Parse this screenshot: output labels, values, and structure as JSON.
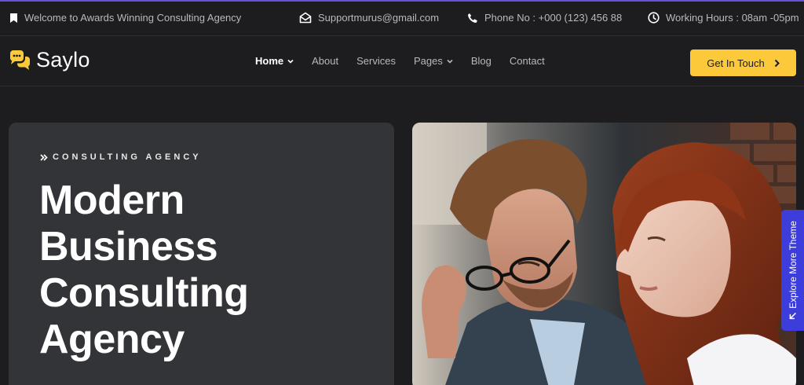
{
  "topbar": {
    "welcome": "Welcome to Awards Winning Consulting Agency",
    "email": "Supportmurus@gmail.com",
    "phone": "Phone No : +000 (123) 456 88",
    "hours": "Working Hours : 08am -05pm"
  },
  "brand": {
    "name": "Saylo",
    "accent": "#fcc93a"
  },
  "nav": {
    "items": [
      {
        "label": "Home",
        "dropdown": true,
        "active": true
      },
      {
        "label": "About"
      },
      {
        "label": "Services"
      },
      {
        "label": "Pages",
        "dropdown": true
      },
      {
        "label": "Blog"
      },
      {
        "label": "Contact"
      }
    ],
    "cta": "Get In Touch"
  },
  "hero": {
    "eyebrow": "CONSULTING AGENCY",
    "title_lines": [
      "Modern",
      "Business",
      "Consulting",
      "Agency"
    ]
  },
  "side_tab": {
    "label": "Explore More Theme",
    "color": "#3c3ddb"
  },
  "icons": [
    "bookmark-icon",
    "mail-icon",
    "phone-icon",
    "clock-icon",
    "chat-bubbles-icon",
    "chevron-down-icon",
    "chevron-right-icon",
    "double-chevron-icon",
    "arrow-up-left-icon"
  ]
}
